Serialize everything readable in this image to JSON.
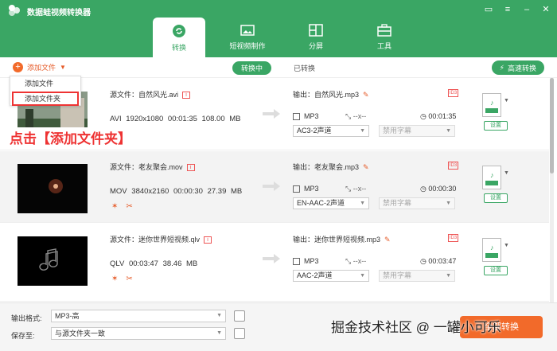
{
  "app": {
    "title": "数据蛙视频转换器"
  },
  "tabs": [
    {
      "label": "转换",
      "icon": "convert-icon",
      "active": true
    },
    {
      "label": "短视频制作",
      "icon": "image-icon",
      "active": false
    },
    {
      "label": "分屏",
      "icon": "split-screen-icon",
      "active": false
    },
    {
      "label": "工具",
      "icon": "toolbox-icon",
      "active": false
    }
  ],
  "toolbar": {
    "add_file": "添加文件",
    "converting": "转换中",
    "converted": "已转换",
    "fast_convert": "高速转换"
  },
  "dropdown": {
    "items": [
      "添加文件",
      "添加文件夹"
    ]
  },
  "annotation": "点击【添加文件夹】",
  "files": [
    {
      "source": "源文件：自然风光.avi",
      "format": "AVI",
      "resolution": "1920x1080",
      "duration": "00:01:35",
      "size": "108.00 MB",
      "output": "输出：自然风光.mp3",
      "out_format": "MP3",
      "out_res": "--x--",
      "out_duration": "00:01:35",
      "audio": "AC3-2声道",
      "subtitle": "禁用字幕",
      "settings": "设置"
    },
    {
      "source": "源文件：老友聚会.mov",
      "format": "MOV",
      "resolution": "3840x2160",
      "duration": "00:00:30",
      "size": "27.39 MB",
      "output": "输出：老友聚会.mp3",
      "out_format": "MP3",
      "out_res": "--x--",
      "out_duration": "00:00:30",
      "audio": "EN-AAC-2声道",
      "subtitle": "禁用字幕",
      "settings": "设置"
    },
    {
      "source": "源文件：迷你世界短视频.qlv",
      "format": "QLV",
      "resolution": "",
      "duration": "00:03:47",
      "size": "38.46 MB",
      "output": "输出：迷你世界短视频.mp3",
      "out_format": "MP3",
      "out_res": "--x--",
      "out_duration": "00:03:47",
      "audio": "AAC-2声道",
      "subtitle": "禁用字幕",
      "settings": "设置"
    }
  ],
  "bottom": {
    "output_format_label": "输出格式:",
    "output_format_value": "MP3-高",
    "save_to_label": "保存至:",
    "save_to_value": "与源文件夹一致",
    "convert_all": "全部转换"
  },
  "watermark": "掘金技术社区 @ 一罐小可乐",
  "colors": {
    "brand": "#3aa664",
    "accent": "#f26a2a",
    "alert": "#e33333"
  }
}
